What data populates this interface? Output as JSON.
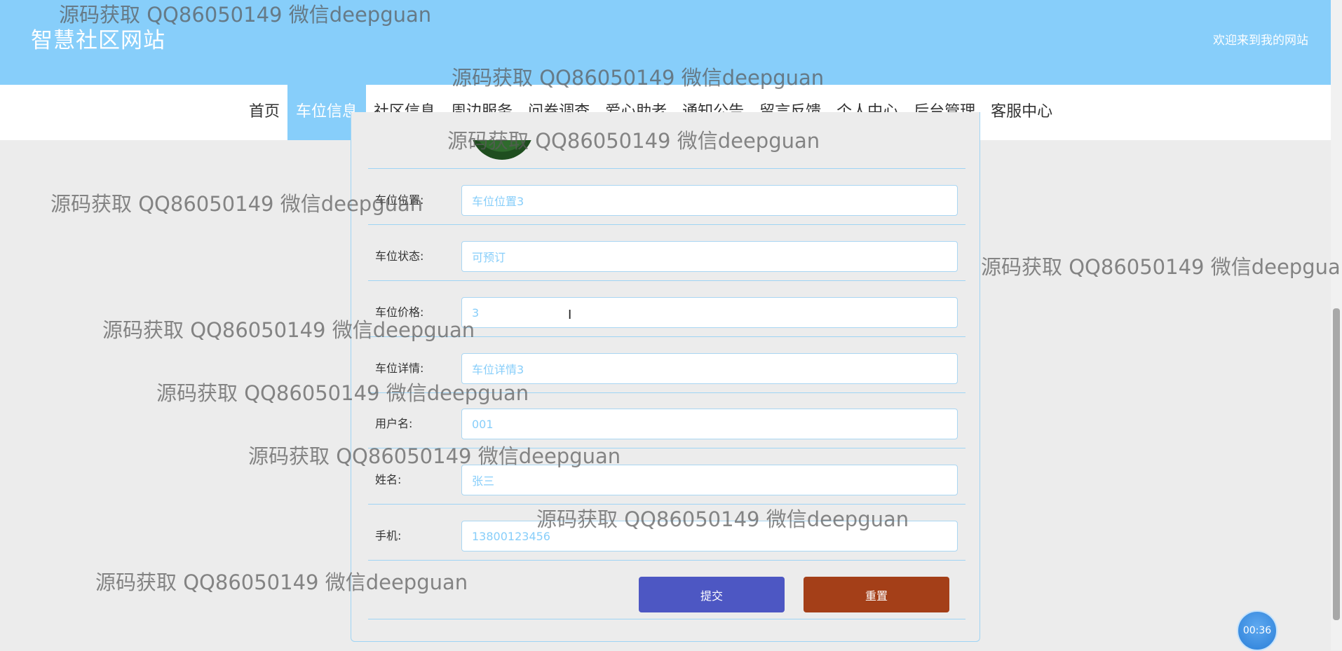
{
  "header": {
    "site_title": "智慧社区网站",
    "welcome": "欢迎来到我的网站"
  },
  "nav": {
    "items": [
      {
        "label": "首页"
      },
      {
        "label": "车位信息",
        "active": true
      },
      {
        "label": "社区信息"
      },
      {
        "label": "周边服务"
      },
      {
        "label": "问卷调查"
      },
      {
        "label": "爱心助老"
      },
      {
        "label": "通知公告"
      },
      {
        "label": "留言反馈"
      },
      {
        "label": "个人中心"
      },
      {
        "label": "后台管理"
      },
      {
        "label": "客服中心"
      }
    ]
  },
  "form": {
    "fields": [
      {
        "label": "车位位置:",
        "value": "车位位置3"
      },
      {
        "label": "车位状态:",
        "value": "可预订"
      },
      {
        "label": "车位价格:",
        "value": "3"
      },
      {
        "label": "车位详情:",
        "value": "车位详情3"
      },
      {
        "label": "用户名:",
        "value": "001"
      },
      {
        "label": "姓名:",
        "value": "张三"
      },
      {
        "label": "手机:",
        "value": "13800123456"
      }
    ],
    "submit_label": "提交",
    "reset_label": "重置"
  },
  "timer": {
    "text": "00:36"
  },
  "watermark": {
    "text": "源码获取 QQ86050149 微信deepguan"
  },
  "colors": {
    "header_bg": "#87cefa",
    "submit": "#4d57c3",
    "reset": "#a43f18"
  }
}
